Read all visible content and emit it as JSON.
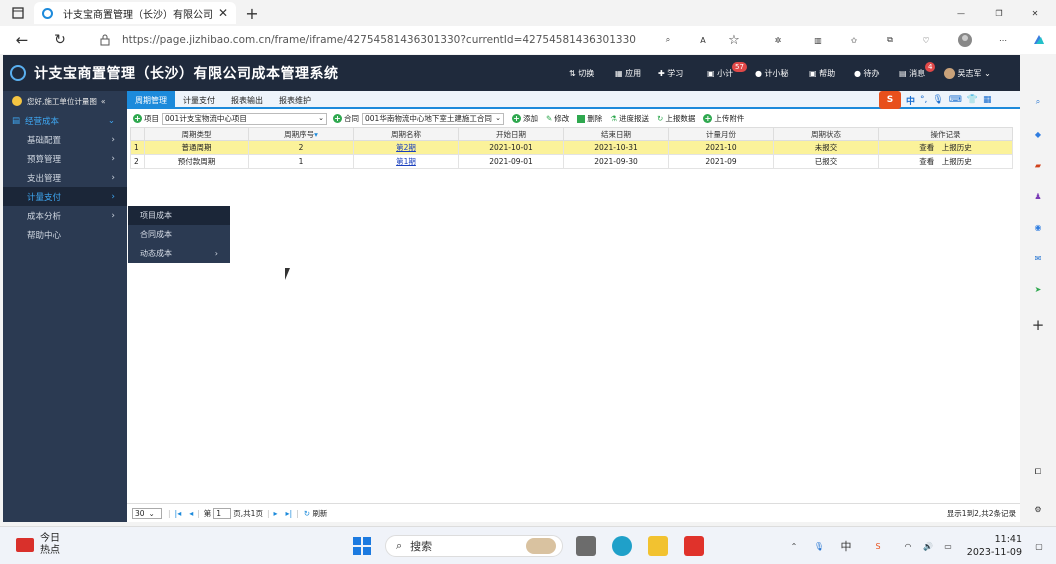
{
  "browser": {
    "tab_title": "计支宝商置管理（长沙）有限公司",
    "url": "https://page.jizhibao.com.cn/frame/iframe/427545814363013​30?currentId=42754581436301330"
  },
  "header": {
    "title": "计支宝商置管理（长沙）有限公司成本管理系统",
    "nav": [
      {
        "label": "切换"
      },
      {
        "label": "应用"
      },
      {
        "label": "学习"
      },
      {
        "label": "小计",
        "badge": "57"
      },
      {
        "label": "计小秘"
      },
      {
        "label": "帮助"
      },
      {
        "label": "待办"
      },
      {
        "label": "消息",
        "badge": "4"
      },
      {
        "label": "吴志军"
      }
    ]
  },
  "sidebar": {
    "user_greeting": "您好,施工单位计量图",
    "group": "经营成本",
    "items": [
      {
        "label": "基础配置"
      },
      {
        "label": "预算管理"
      },
      {
        "label": "支出管理"
      },
      {
        "label": "计量支付"
      },
      {
        "label": "成本分析"
      },
      {
        "label": "帮助中心"
      }
    ],
    "flyout": [
      "项目成本",
      "合同成本",
      "动态成本"
    ]
  },
  "subtabs": [
    "周期管理",
    "计量支付",
    "报表输出",
    "报表维护"
  ],
  "toolbar": {
    "project_label": "项目",
    "project_value": "001计支宝物流中心项目",
    "contract_label": "合同",
    "contract_value": "001华南物流中心地下室土建施工合同",
    "buttons": [
      "添加",
      "修改",
      "删除",
      "进度报送",
      "上报数据",
      "上传附件"
    ]
  },
  "table": {
    "headers": [
      "周期类型",
      "周期序号",
      "周期名称",
      "开始日期",
      "结束日期",
      "计量月份",
      "周期状态",
      "操作记录"
    ],
    "rows": [
      {
        "idx": "1",
        "type": "普通周期",
        "seq": "2",
        "name": "第2期",
        "start": "2021-10-01",
        "end": "2021-10-31",
        "month": "2021-10",
        "status": "未报交",
        "ops": "查看　上报历史"
      },
      {
        "idx": "2",
        "type": "预付款周期",
        "seq": "1",
        "name": "第1期",
        "start": "2021-09-01",
        "end": "2021-09-30",
        "month": "2021-09",
        "status": "已报交",
        "ops": "查看　上报历史"
      }
    ]
  },
  "pager": {
    "page_size": "30",
    "page_label_pre": "第",
    "page_value": "1",
    "page_label_post": "页,共1页",
    "refresh": "刷新",
    "summary": "显示1到2,共2条记录"
  },
  "taskbar": {
    "weather_line1": "今日",
    "weather_line2": "热点",
    "search_placeholder": "搜索",
    "ime": "中",
    "time": "11:41",
    "date": "2023-11-09"
  },
  "ime_bar": {
    "label": "中"
  },
  "colors": {
    "header_bg": "#1f2a3c",
    "sidebar_bg": "#2b3a52",
    "accent": "#1c8adb",
    "highlight_row": "#fbf29a"
  }
}
